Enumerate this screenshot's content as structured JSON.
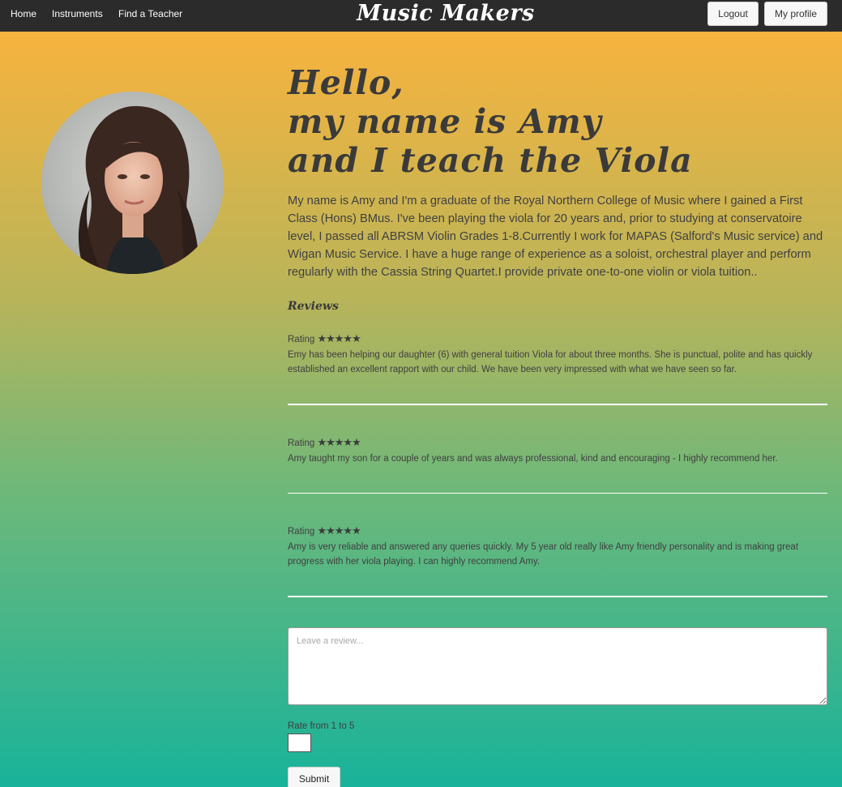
{
  "nav": {
    "links": [
      "Home",
      "Instruments",
      "Find a Teacher"
    ],
    "brand": "Music Makers",
    "logout_label": "Logout",
    "profile_label": "My profile"
  },
  "profile": {
    "greeting_lines": [
      "Hello,",
      "my name is Amy",
      "and I teach the Viola"
    ],
    "bio": "My name is Amy and I'm a graduate of the Royal Northern College of Music where I gained a First Class (Hons) BMus. I've been playing the viola for 20 years and, prior to studying at conservatoire level, I passed all ABRSM Violin Grades 1-8.Currently I work for MAPAS (Salford's Music service) and Wigan Music Service. I have a huge range of experience as a soloist, orchestral player and perform regularly with the Cassia String Quartet.I provide private one-to-one violin or viola tuition.."
  },
  "reviews": {
    "heading": "Reviews",
    "rating_label": "Rating",
    "items": [
      {
        "stars": "★★★★★",
        "text": "Emy has been helping our daughter (6) with general tuition Viola for about three months. She is punctual, polite and has quickly established an excellent rapport with our child. We have been very impressed with what we have seen so far."
      },
      {
        "stars": "★★★★★",
        "text": "Amy taught my son for a couple of years and was always professional, kind and encouraging - I highly recommend her."
      },
      {
        "stars": "★★★★★",
        "text": "Amy is very reliable and answered any queries quickly. My 5 year old really like Amy friendly personality and is making great progress with her viola playing. I can highly recommend Amy."
      }
    ]
  },
  "form": {
    "review_placeholder": "Leave a review...",
    "rate_label": "Rate from 1 to 5",
    "submit_label": "Submit"
  }
}
